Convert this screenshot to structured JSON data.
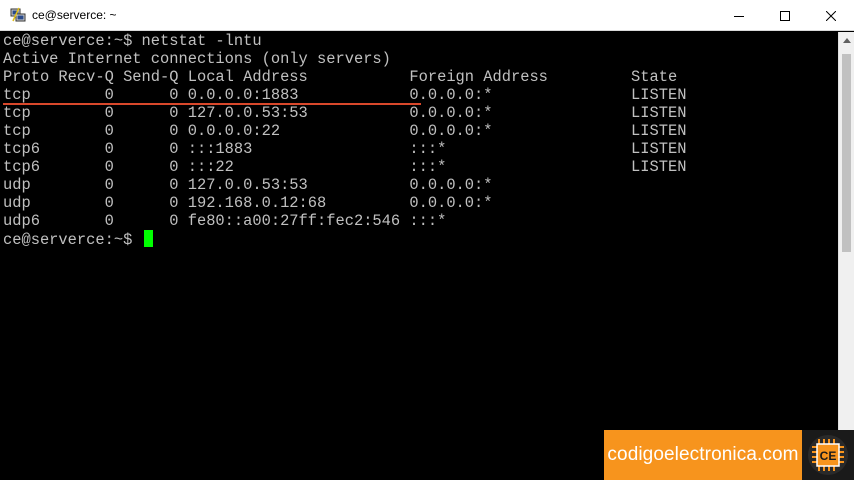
{
  "window": {
    "title": "ce@serverce: ~",
    "minimize_glyph": "—",
    "maximize_glyph": "☐",
    "close_glyph": "✕"
  },
  "terminal": {
    "lines": [
      "ce@serverce:~$ netstat -lntu",
      "Active Internet connections (only servers)",
      "Proto Recv-Q Send-Q Local Address           Foreign Address         State",
      "tcp        0      0 0.0.0.0:1883            0.0.0.0:*               LISTEN",
      "tcp        0      0 127.0.0.53:53           0.0.0.0:*               LISTEN",
      "tcp        0      0 0.0.0.0:22              0.0.0.0:*               LISTEN",
      "tcp6       0      0 :::1883                 :::*                    LISTEN",
      "tcp6       0      0 :::22                   :::*                    LISTEN",
      "udp        0      0 127.0.0.53:53           0.0.0.0:*",
      "udp        0      0 192.168.0.12:68         0.0.0.0:*",
      "udp6       0      0 fe80::a00:27ff:fec2:546 :::*"
    ],
    "prompt": "ce@serverce:~$ "
  },
  "brand": {
    "text": "codigoelectronica.com",
    "logo_text": "CE",
    "color": "#f7941d"
  },
  "colors": {
    "terminal_fg": "#c0c0c0",
    "terminal_bg": "#000000",
    "cursor": "#00ff00",
    "highlight_underline": "#d9482b"
  }
}
